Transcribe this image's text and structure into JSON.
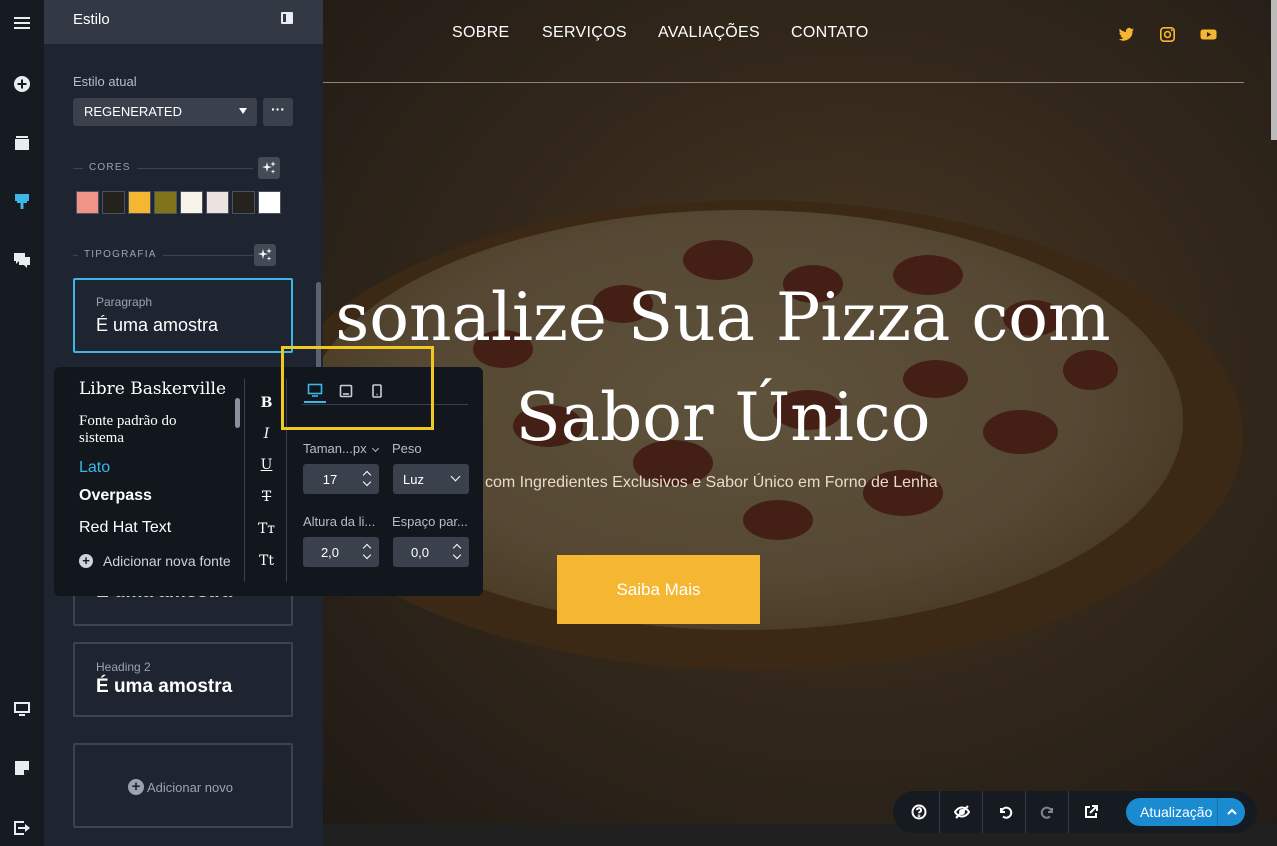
{
  "panel": {
    "title": "Estilo",
    "current_style_label": "Estilo atual",
    "current_style_value": "REGENERATED",
    "more_label": "···",
    "colors_label": "CORES",
    "swatches": [
      "#ef9486",
      "#25221d",
      "#f5b731",
      "#7f7419",
      "#f7f2ea",
      "#eae3e0",
      "#26231f",
      "#ffffff"
    ],
    "typography_label": "TIPOGRAFIA",
    "cards": {
      "paragraph": {
        "label": "Paragraph",
        "sample": "É uma amostra"
      },
      "heading1": {
        "sample": "É uma amostra"
      },
      "heading2": {
        "label": "Heading 2",
        "sample": "É uma amostra"
      },
      "add_new": "Adicionar novo"
    }
  },
  "popover": {
    "fonts": {
      "libre": "Libre Baskerville",
      "default": "Fonte padrão do sistema",
      "lato": "Lato",
      "overpass": "Overpass",
      "redhat": "Red Hat Text",
      "add": "Adicionar nova fonte"
    },
    "format": {
      "bold": "B",
      "italic": "I",
      "underline": "U",
      "strike": "T",
      "titlecase": "Tт",
      "smallcaps": "Tt"
    },
    "size_label": "Taman...px",
    "size_value": "17",
    "weight_label": "Peso",
    "weight_value": "Luz",
    "line_height_label": "Altura da li...",
    "line_height_value": "2,0",
    "spacing_label": "Espaço par...",
    "spacing_value": "0,0"
  },
  "site": {
    "nav": [
      "SOBRE",
      "SERVIÇOS",
      "AVALIAÇÕES",
      "CONTATO"
    ],
    "social_icon_color": "#f5b731",
    "hero_title_line1": "sonalize Sua Pizza com",
    "hero_title_line2": "Sabor Único",
    "hero_subtitle": "com Ingredientes Exclusivos e Sabor Único em Forno de Lenha",
    "cta": "Saiba Mais"
  },
  "toolbar": {
    "update_label": "Atualização",
    "accent": "#1a8bd1"
  },
  "accent_color": "#3cb7e8",
  "highlight_color": "#f1c81f"
}
